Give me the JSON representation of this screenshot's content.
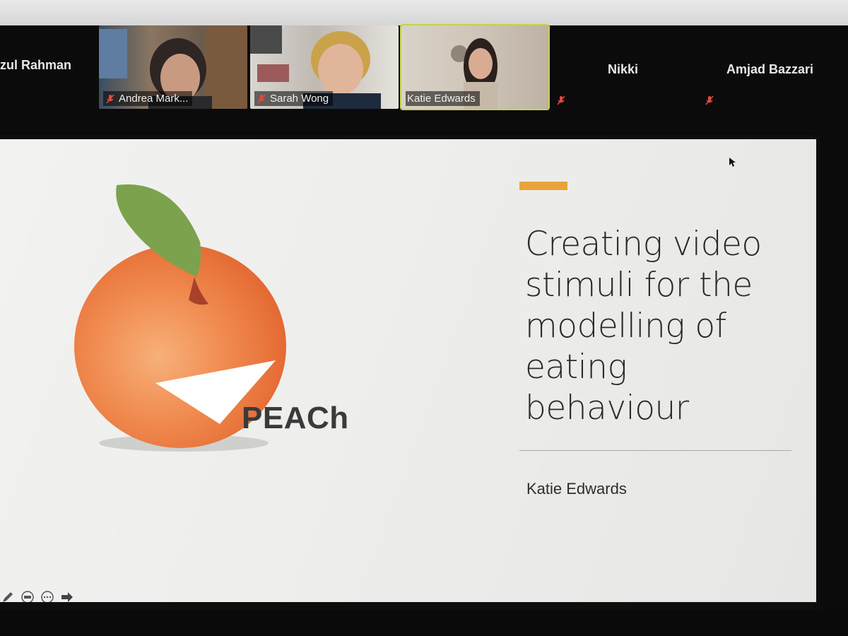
{
  "participants": {
    "left_name": "zul Rahman",
    "tiles": [
      {
        "name": "Andrea Mark..."
      },
      {
        "name": "Sarah Wong"
      },
      {
        "name": "Katie Edwards"
      }
    ],
    "audio_only": [
      {
        "name": "Nikki"
      },
      {
        "name": "Amjad Bazzari"
      }
    ]
  },
  "slide": {
    "title": "Creating video stimuli for the modelling of eating behaviour",
    "presenter": "Katie Edwards",
    "logo_text": "PEACh",
    "accent_color": "#e8a33a"
  },
  "icons": {
    "mic_off": "mic-off-icon",
    "pen": "pen-icon",
    "captions": "captions-icon",
    "more": "more-icon",
    "next": "arrow-right-icon",
    "cursor": "cursor-icon"
  }
}
